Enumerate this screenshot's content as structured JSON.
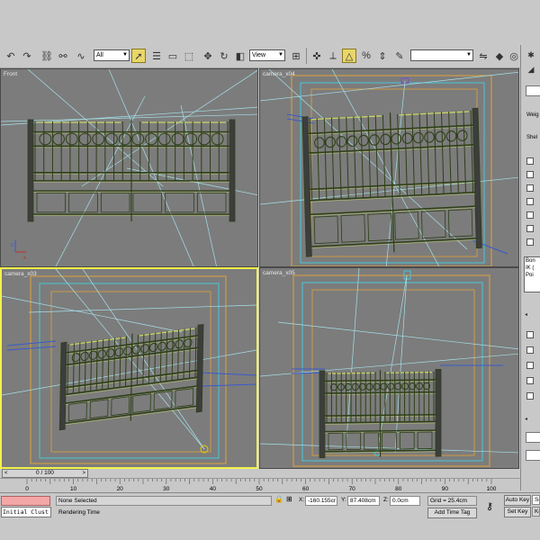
{
  "toolbar": {
    "selection_filter": "All",
    "reference_coordinate": "View",
    "named_selection": "",
    "icons": [
      "undo-icon",
      "redo-icon",
      "select-link-icon",
      "unlink-icon",
      "bind-spacewarp-icon",
      "select-object-icon",
      "select-by-name-icon",
      "rect-region-icon",
      "window-crossing-icon",
      "move-icon",
      "rotate-icon",
      "scale-icon",
      "pivot-icon",
      "snaps-toggle-icon",
      "angle-snap-icon",
      "percent-snap-icon",
      "spinner-snap-icon",
      "mirror-icon",
      "align-icon",
      "material-editor-icon",
      "render-scene-icon"
    ]
  },
  "command_panel": {
    "label_weight": "Weig",
    "label_shell": "Shel",
    "list_items": [
      "Bon",
      "IK (",
      "Poi"
    ]
  },
  "viewports": {
    "front": {
      "label": "Front"
    },
    "camera_04": {
      "label": "camera_x04"
    },
    "camera_03": {
      "label": "camera_x03"
    },
    "camera_05": {
      "label": "camera_x05"
    }
  },
  "time_slider": {
    "position": "0 / 100",
    "prev": "<",
    "next": ">"
  },
  "trackbar": {
    "ticks": [
      "0",
      "10",
      "20",
      "30",
      "40",
      "50",
      "60",
      "70",
      "80",
      "90",
      "100"
    ]
  },
  "status": {
    "selection_status": "None Selected",
    "prompt": "Rendering Time",
    "script_listener": "Initial Clust",
    "x_label": "X:",
    "x_value": "-160.155cr",
    "y_label": "Y:",
    "y_value": "87.408cm",
    "z_label": "Z:",
    "z_value": "0.0cm",
    "grid": "Grid = 25.4cm",
    "add_time_tag": "Add Time Tag",
    "auto_key": "Auto Key",
    "set_key": "Set Key",
    "selected_set": "Se",
    "key_filters": "Ke"
  },
  "colors": {
    "viewport_bg": "#7c7c7c",
    "active_border": "#f2f24a",
    "gate_wire": "#2e3f18",
    "gate_highlight": "#c9d36a",
    "camera_line": "#a6e0ea",
    "safe_frame_orange": "#e0a23a",
    "safe_frame_cyan": "#46c8d8",
    "grid_blue": "#3a5acc"
  }
}
